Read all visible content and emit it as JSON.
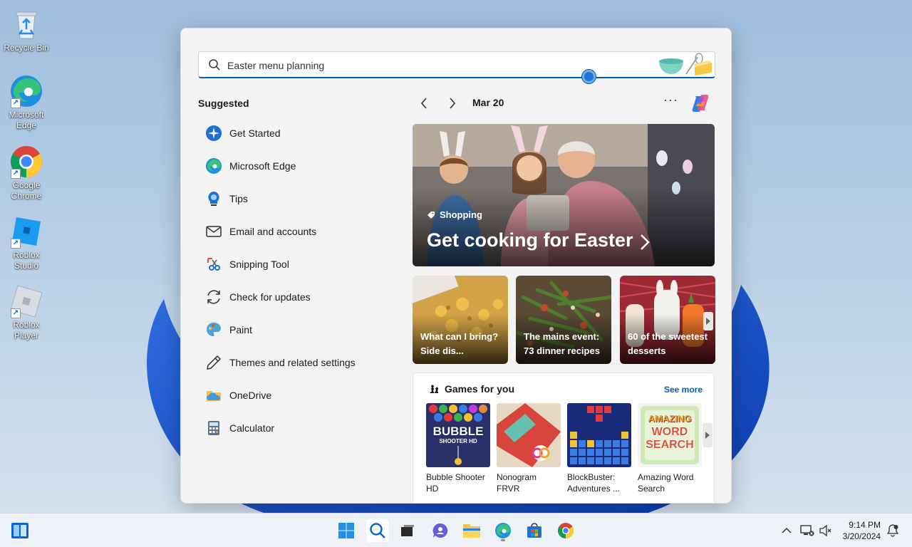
{
  "desktop": {
    "icons": [
      {
        "label": "Recycle Bin"
      },
      {
        "label": "Microsoft Edge"
      },
      {
        "label": "Google Chrome"
      },
      {
        "label": "Roblox Studio"
      },
      {
        "label": "Roblox Player"
      }
    ]
  },
  "search": {
    "value": "Easter menu planning"
  },
  "suggested": {
    "title": "Suggested",
    "items": [
      {
        "label": "Get Started",
        "icon": "get-started-icon"
      },
      {
        "label": "Microsoft Edge",
        "icon": "edge-icon"
      },
      {
        "label": "Tips",
        "icon": "tips-icon"
      },
      {
        "label": "Email and accounts",
        "icon": "mail-icon"
      },
      {
        "label": "Snipping Tool",
        "icon": "snipping-tool-icon"
      },
      {
        "label": "Check for updates",
        "icon": "refresh-icon"
      },
      {
        "label": "Paint",
        "icon": "paint-icon"
      },
      {
        "label": "Themes and related settings",
        "icon": "pen-icon"
      },
      {
        "label": "OneDrive",
        "icon": "onedrive-icon"
      },
      {
        "label": "Calculator",
        "icon": "calculator-icon"
      }
    ]
  },
  "highlights": {
    "date": "Mar 20",
    "more": "···",
    "hero": {
      "tag": "Shopping",
      "headline": "Get cooking for Easter"
    },
    "cards": [
      {
        "text": "What can I bring? Side dis..."
      },
      {
        "text": "The mains event: 73 dinner recipes"
      },
      {
        "text": "60 of the sweetest desserts"
      }
    ]
  },
  "games": {
    "title": "Games for you",
    "see_more": "See more",
    "items": [
      {
        "name": "Bubble Shooter HD",
        "tile_text": "BUBBLE",
        "tile_sub": "SHOOTER HD"
      },
      {
        "name": "Nonogram FRVR"
      },
      {
        "name": "BlockBuster: Adventures ..."
      },
      {
        "name": "Amazing Word Search",
        "tile_text": "AMAZING",
        "tile_sub": "WORD SEARCH"
      }
    ]
  },
  "taskbar": {
    "time": "9:14 PM",
    "date": "3/20/2024"
  },
  "colors": {
    "accent": "#005fb8",
    "panel_bg": "#f3f3f3"
  }
}
